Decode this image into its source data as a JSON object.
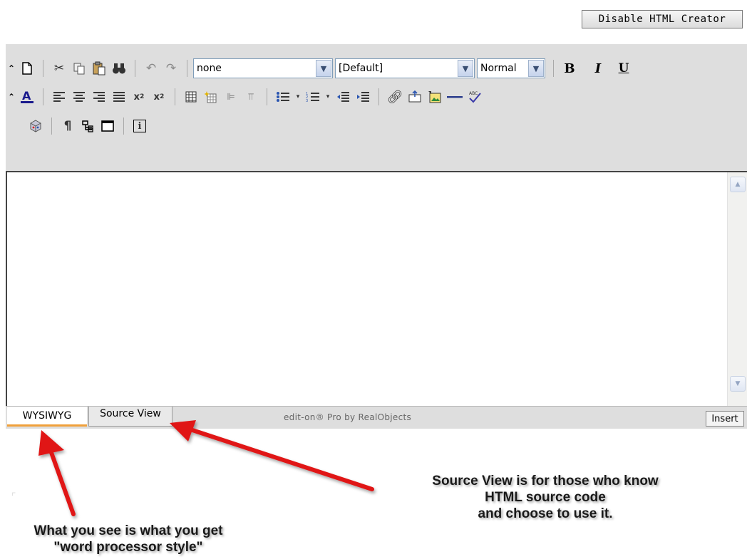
{
  "header": {
    "disable_button": "Disable HTML Creator"
  },
  "toolbar": {
    "style_select": "none",
    "font_select": "[Default]",
    "size_select": "Normal",
    "bold": "B",
    "italic": "I",
    "underline": "U",
    "info": "i",
    "paragraph": "¶"
  },
  "tabs": [
    {
      "label": "WYSIWYG",
      "active": true
    },
    {
      "label": "Source View",
      "active": false
    }
  ],
  "status": {
    "credit": "edit-on® Pro by RealObjects",
    "mode": "Insert"
  },
  "annotations": {
    "left": [
      "What you see is what you get",
      "\"word processor style\""
    ],
    "right": [
      "Source View is for those who know",
      "HTML source code",
      "and choose to use it."
    ]
  },
  "colors": {
    "arrow": "#e01515",
    "toolbar_bg": "#dedede",
    "active_tab_accent": "#f0a03a"
  }
}
